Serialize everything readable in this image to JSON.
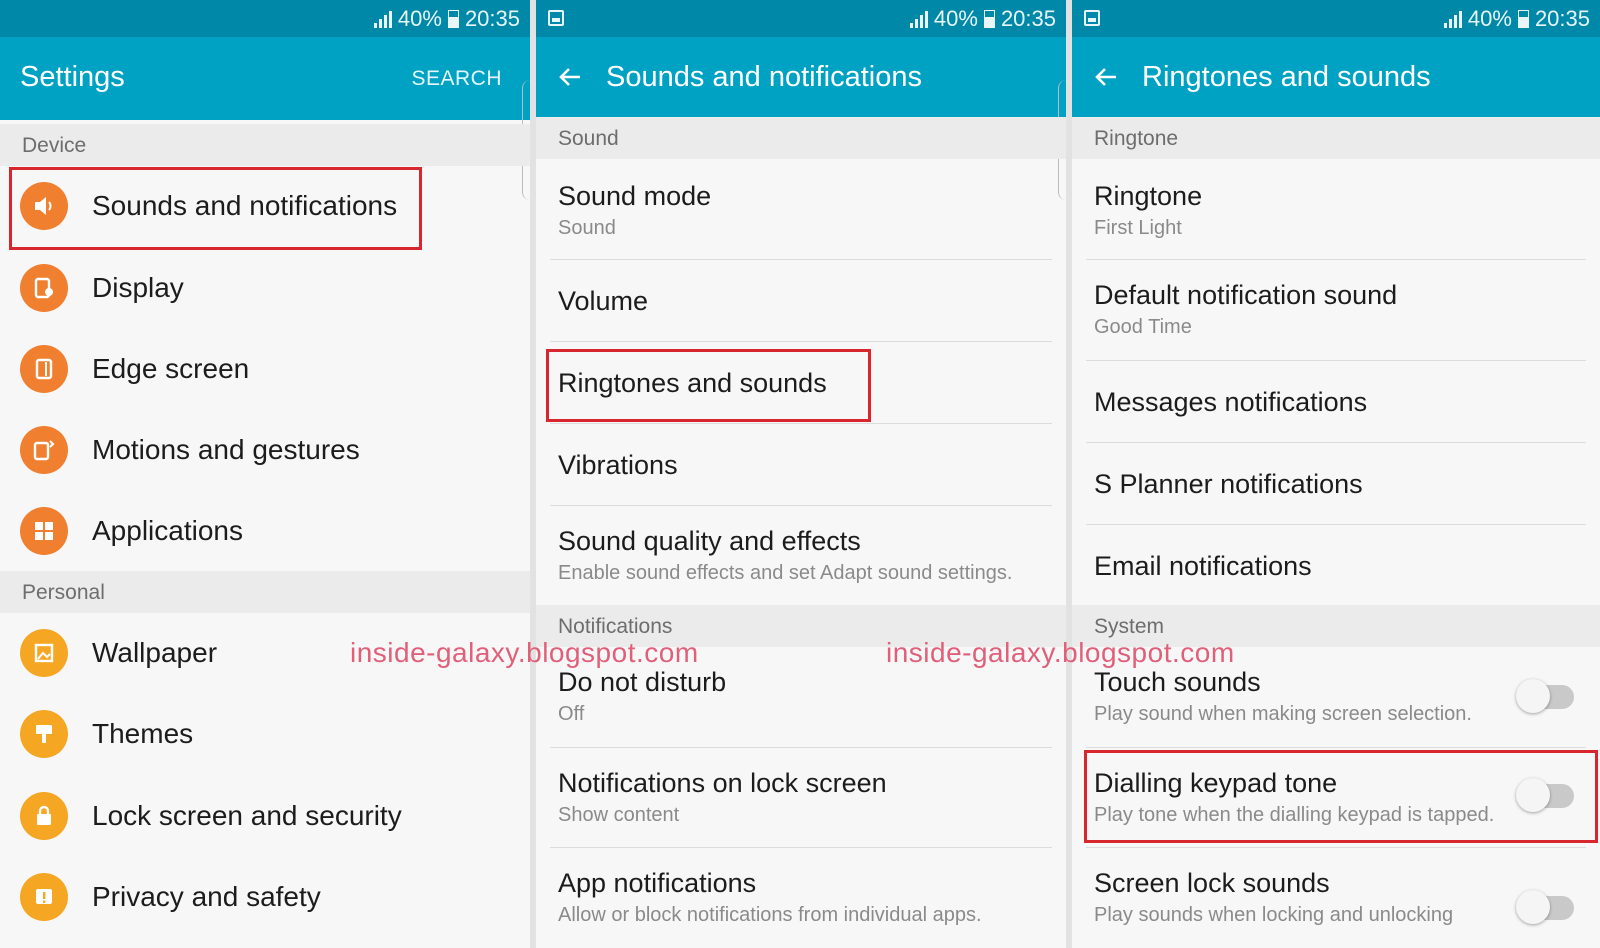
{
  "statusbar": {
    "battery": "40%",
    "time": "20:35"
  },
  "panel1": {
    "title": "Settings",
    "search_label": "SEARCH",
    "section_device": "Device",
    "section_personal": "Personal",
    "items": [
      {
        "label": "Sounds and notifications",
        "icon": "speaker-icon"
      },
      {
        "label": "Display",
        "icon": "display-icon"
      },
      {
        "label": "Edge screen",
        "icon": "edge-screen-icon"
      },
      {
        "label": "Motions and gestures",
        "icon": "motions-icon"
      },
      {
        "label": "Applications",
        "icon": "applications-icon"
      },
      {
        "label": "Wallpaper",
        "icon": "wallpaper-icon"
      },
      {
        "label": "Themes",
        "icon": "themes-icon"
      },
      {
        "label": "Lock screen and security",
        "icon": "lock-icon"
      },
      {
        "label": "Privacy and safety",
        "icon": "privacy-icon"
      }
    ]
  },
  "panel2": {
    "title": "Sounds and notifications",
    "section_sound": "Sound",
    "section_notifications": "Notifications",
    "items": [
      {
        "title": "Sound mode",
        "subtitle": "Sound"
      },
      {
        "title": "Volume",
        "subtitle": ""
      },
      {
        "title": "Ringtones and sounds",
        "subtitle": ""
      },
      {
        "title": "Vibrations",
        "subtitle": ""
      },
      {
        "title": "Sound quality and effects",
        "subtitle": "Enable sound effects and set Adapt sound settings."
      },
      {
        "title": "Do not disturb",
        "subtitle": "Off"
      },
      {
        "title": "Notifications on lock screen",
        "subtitle": "Show content"
      },
      {
        "title": "App notifications",
        "subtitle": "Allow or block notifications from individual apps."
      }
    ]
  },
  "panel3": {
    "title": "Ringtones and sounds",
    "section_ringtone": "Ringtone",
    "section_system": "System",
    "items": [
      {
        "title": "Ringtone",
        "subtitle": "First Light"
      },
      {
        "title": "Default notification sound",
        "subtitle": "Good Time"
      },
      {
        "title": "Messages notifications",
        "subtitle": ""
      },
      {
        "title": "S Planner notifications",
        "subtitle": ""
      },
      {
        "title": "Email notifications",
        "subtitle": ""
      },
      {
        "title": "Touch sounds",
        "subtitle": "Play sound when making screen selection.",
        "toggle": "off"
      },
      {
        "title": "Dialling keypad tone",
        "subtitle": "Play tone when the dialling keypad is tapped.",
        "toggle": "off"
      },
      {
        "title": "Screen lock sounds",
        "subtitle": "Play sounds when locking and unlocking",
        "toggle": "off"
      }
    ]
  },
  "watermark": "inside-galaxy.blogspot.com",
  "colors": {
    "statusbar": "#0088a8",
    "appbar": "#00a2c4",
    "highlight": "#d8262f",
    "icon_orange": "#f08030",
    "icon_amber": "#f5a623"
  }
}
